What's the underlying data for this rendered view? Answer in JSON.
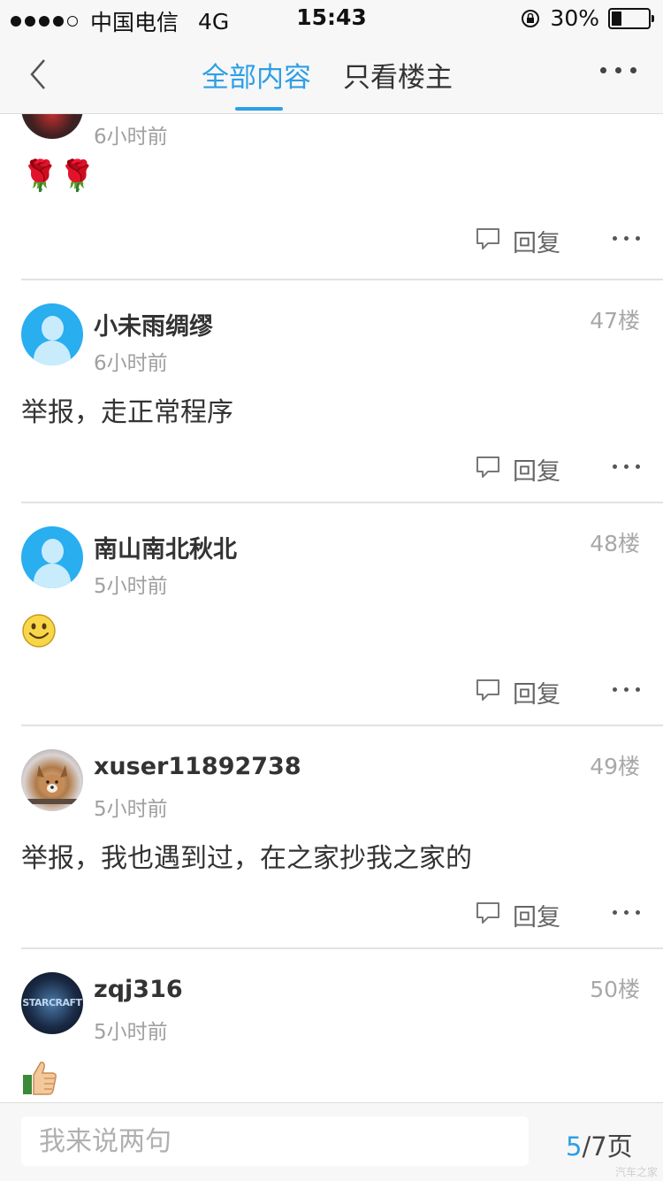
{
  "status_bar": {
    "carrier": "中国电信",
    "network": "4G",
    "time": "15:43",
    "battery": "30%",
    "battery_level": 0.3
  },
  "nav": {
    "tab_all": "全部内容",
    "tab_op_only": "只看楼主"
  },
  "posts": [
    {
      "time": "6小时前",
      "content_emoji": "🌹🌹",
      "reply_label": "回复"
    },
    {
      "username": "小未雨绸缪",
      "time": "6小时前",
      "floor": "47楼",
      "content": "举报，走正常程序",
      "reply_label": "回复"
    },
    {
      "username": "南山南北秋北",
      "time": "5小时前",
      "floor": "48楼",
      "content_emoji": "smiley-emoji",
      "reply_label": "回复"
    },
    {
      "username": "xuser11892738",
      "time": "5小时前",
      "floor": "49楼",
      "content": "举报，我也遇到过，在之家抄我之家的",
      "reply_label": "回复"
    },
    {
      "username": "zqj316",
      "time": "5小时前",
      "floor": "50楼",
      "avatar_text": "STARCRAFT",
      "content_emoji": "thumbs-up-emoji"
    }
  ],
  "bottom": {
    "input_placeholder": "我来说两句",
    "page_current": "5",
    "page_total": "/7页",
    "watermark": "汽车之家"
  },
  "colors": {
    "accent": "#2e9fe6",
    "avatar_default": "#29aef0"
  }
}
